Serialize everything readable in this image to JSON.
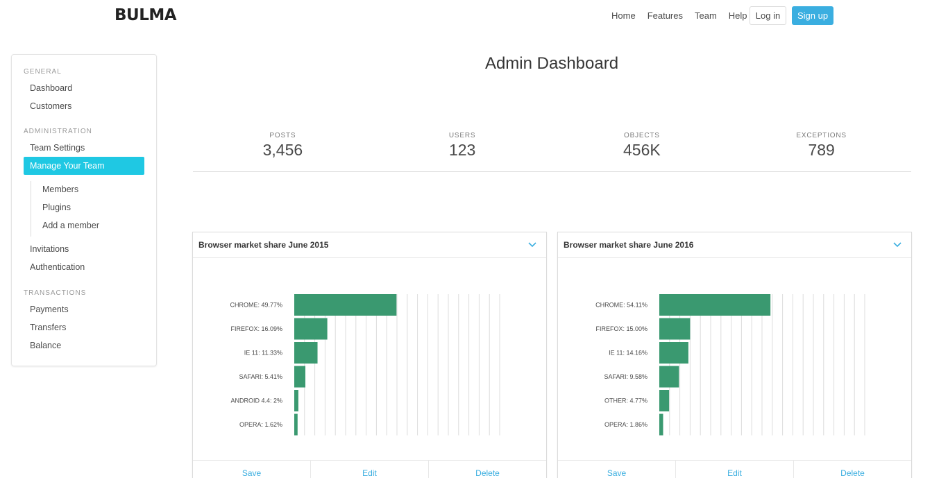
{
  "navbar": {
    "logo": "BULMA",
    "links": [
      "Home",
      "Features",
      "Team",
      "Help"
    ],
    "login": "Log in",
    "signup": "Sign up"
  },
  "sidebar": {
    "general_label": "GENERAL",
    "general_items": [
      "Dashboard",
      "Customers"
    ],
    "admin_label": "ADMINISTRATION",
    "team_settings": "Team Settings",
    "active_item": "Manage Your Team",
    "sub_items": [
      "Members",
      "Plugins",
      "Add a member"
    ],
    "admin_items": [
      "Invitations",
      "Authentication"
    ],
    "transactions_label": "TRANSACTIONS",
    "transaction_items": [
      "Payments",
      "Transfers",
      "Balance"
    ]
  },
  "main": {
    "title": "Admin Dashboard",
    "stats": [
      {
        "label": "POSTS",
        "value": "3,456"
      },
      {
        "label": "USERS",
        "value": "123"
      },
      {
        "label": "OBJECTS",
        "value": "456K"
      },
      {
        "label": "EXCEPTIONS",
        "value": "789"
      }
    ]
  },
  "colors": {
    "bar": "#3a9970",
    "accent": "#1fc8e3",
    "link": "#3aaee0"
  },
  "cards": [
    {
      "title": "Browser market share June 2015",
      "footer": [
        "Save",
        "Edit",
        "Delete"
      ]
    },
    {
      "title": "Browser market share June 2016",
      "footer": [
        "Save",
        "Edit",
        "Delete"
      ]
    }
  ],
  "chart_data": [
    {
      "type": "bar",
      "orientation": "horizontal",
      "title": "Browser market share June 2015",
      "categories": [
        "CHROME: 49.77%",
        "FIREFOX: 16.09%",
        "IE 11: 11.33%",
        "SAFARI: 5.41%",
        "ANDROID 4.4: 2%",
        "OPERA: 1.62%"
      ],
      "values": [
        49.77,
        16.09,
        11.33,
        5.41,
        2,
        1.62
      ],
      "xlim": [
        0,
        100
      ],
      "grid": true
    },
    {
      "type": "bar",
      "orientation": "horizontal",
      "title": "Browser market share June 2016",
      "categories": [
        "CHROME: 54.11%",
        "FIREFOX: 15.00%",
        "IE 11: 14.16%",
        "SAFARI: 9.58%",
        "OTHER: 4.77%",
        "OPERA: 1.86%"
      ],
      "values": [
        54.11,
        15.0,
        14.16,
        9.58,
        4.77,
        1.86
      ],
      "xlim": [
        0,
        100
      ],
      "grid": true
    }
  ]
}
